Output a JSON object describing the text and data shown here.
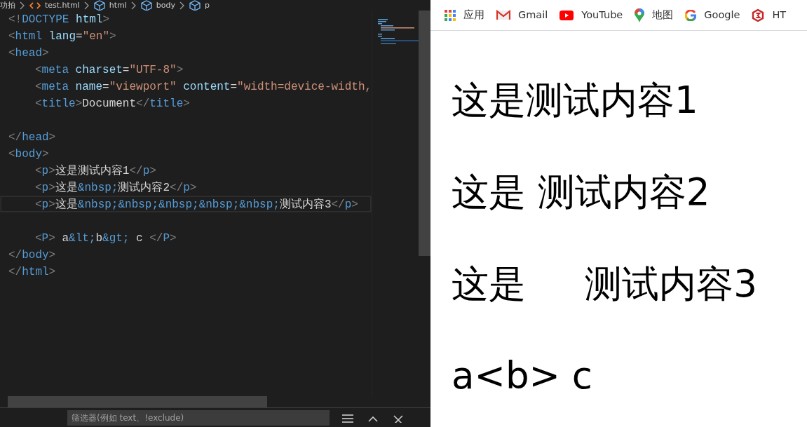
{
  "breadcrumb": [
    {
      "label": "功拍",
      "kind": "folder"
    },
    {
      "label": "test.html",
      "kind": "file"
    },
    {
      "label": "html",
      "kind": "element"
    },
    {
      "label": "body",
      "kind": "element"
    },
    {
      "label": "p",
      "kind": "element"
    }
  ],
  "code_lines": [
    {
      "current": false,
      "indented": false,
      "tokens": [
        {
          "kind": "punct",
          "text": "<!"
        },
        {
          "kind": "tag",
          "text": "DOCTYPE"
        },
        {
          "kind": "attr",
          "text": " html"
        },
        {
          "kind": "punct",
          "text": ">"
        }
      ]
    },
    {
      "current": false,
      "indented": false,
      "tokens": [
        {
          "kind": "punct",
          "text": "<"
        },
        {
          "kind": "tag",
          "text": "html"
        },
        {
          "kind": "attr",
          "text": " lang"
        },
        {
          "kind": "plain",
          "text": "="
        },
        {
          "kind": "string",
          "text": "\"en\""
        },
        {
          "kind": "punct",
          "text": ">"
        }
      ]
    },
    {
      "current": false,
      "indented": false,
      "tokens": [
        {
          "kind": "punct",
          "text": "<"
        },
        {
          "kind": "tag",
          "text": "head"
        },
        {
          "kind": "punct",
          "text": ">"
        }
      ]
    },
    {
      "current": false,
      "indented": true,
      "tokens": [
        {
          "kind": "punct",
          "text": "<"
        },
        {
          "kind": "tag",
          "text": "meta"
        },
        {
          "kind": "attr",
          "text": " charset"
        },
        {
          "kind": "plain",
          "text": "="
        },
        {
          "kind": "string",
          "text": "\"UTF-8\""
        },
        {
          "kind": "punct",
          "text": ">"
        }
      ]
    },
    {
      "current": false,
      "indented": true,
      "tokens": [
        {
          "kind": "punct",
          "text": "<"
        },
        {
          "kind": "tag",
          "text": "meta"
        },
        {
          "kind": "attr",
          "text": " name"
        },
        {
          "kind": "plain",
          "text": "="
        },
        {
          "kind": "string",
          "text": "\"viewport\""
        },
        {
          "kind": "attr",
          "text": " content"
        },
        {
          "kind": "plain",
          "text": "="
        },
        {
          "kind": "string",
          "text": "\"width=device-width,"
        }
      ]
    },
    {
      "current": false,
      "indented": true,
      "tokens": [
        {
          "kind": "punct",
          "text": "<"
        },
        {
          "kind": "tag",
          "text": "title"
        },
        {
          "kind": "punct",
          "text": ">"
        },
        {
          "kind": "plain",
          "text": "Document"
        },
        {
          "kind": "punct",
          "text": "</"
        },
        {
          "kind": "tag",
          "text": "title"
        },
        {
          "kind": "punct",
          "text": ">"
        }
      ]
    },
    {
      "current": false
    },
    {
      "current": false,
      "indented": false,
      "tokens": [
        {
          "kind": "punct",
          "text": "</"
        },
        {
          "kind": "tag",
          "text": "head"
        },
        {
          "kind": "punct",
          "text": ">"
        }
      ]
    },
    {
      "current": false,
      "indented": false,
      "tokens": [
        {
          "kind": "punct",
          "text": "<"
        },
        {
          "kind": "tag",
          "text": "body"
        },
        {
          "kind": "punct",
          "text": ">"
        }
      ]
    },
    {
      "current": false,
      "indented": true,
      "tokens": [
        {
          "kind": "punct",
          "text": "<"
        },
        {
          "kind": "tag",
          "text": "p"
        },
        {
          "kind": "punct",
          "text": ">"
        },
        {
          "kind": "plain",
          "text": "这是测试内容1"
        },
        {
          "kind": "punct",
          "text": "</"
        },
        {
          "kind": "tag",
          "text": "p"
        },
        {
          "kind": "punct",
          "text": ">"
        }
      ]
    },
    {
      "current": false,
      "indented": true,
      "tokens": [
        {
          "kind": "punct",
          "text": "<"
        },
        {
          "kind": "tag",
          "text": "p"
        },
        {
          "kind": "punct",
          "text": ">"
        },
        {
          "kind": "plain",
          "text": "这是"
        },
        {
          "kind": "entity",
          "text": "&nbsp;"
        },
        {
          "kind": "plain",
          "text": "测试内容2"
        },
        {
          "kind": "punct",
          "text": "</"
        },
        {
          "kind": "tag",
          "text": "p"
        },
        {
          "kind": "punct",
          "text": ">"
        }
      ]
    },
    {
      "current": true,
      "indented": true,
      "tokens": [
        {
          "kind": "punct",
          "text": "<"
        },
        {
          "kind": "tag",
          "text": "p"
        },
        {
          "kind": "punct",
          "text": ">"
        },
        {
          "kind": "plain",
          "text": "这是"
        },
        {
          "kind": "entity",
          "text": "&nbsp;&nbsp;&nbsp;&nbsp;&nbsp;"
        },
        {
          "kind": "plain",
          "text": "测试内容3"
        },
        {
          "kind": "punct",
          "text": "</"
        },
        {
          "kind": "tag",
          "text": "p"
        },
        {
          "kind": "punct",
          "text": ">"
        }
      ]
    },
    {
      "current": false
    },
    {
      "current": false,
      "indented": true,
      "tokens": [
        {
          "kind": "punct",
          "text": "<"
        },
        {
          "kind": "tag",
          "text": "P"
        },
        {
          "kind": "punct",
          "text": ">"
        },
        {
          "kind": "plain",
          "text": " a"
        },
        {
          "kind": "entity",
          "text": "&lt;"
        },
        {
          "kind": "plain",
          "text": "b"
        },
        {
          "kind": "entity",
          "text": "&gt;"
        },
        {
          "kind": "plain",
          "text": " c "
        },
        {
          "kind": "punct",
          "text": "</"
        },
        {
          "kind": "tag",
          "text": "P"
        },
        {
          "kind": "punct",
          "text": ">"
        }
      ]
    },
    {
      "current": false,
      "indented": false,
      "tokens": [
        {
          "kind": "punct",
          "text": "</"
        },
        {
          "kind": "tag",
          "text": "body"
        },
        {
          "kind": "punct",
          "text": ">"
        }
      ]
    },
    {
      "current": false,
      "indented": false,
      "tokens": [
        {
          "kind": "punct",
          "text": "</"
        },
        {
          "kind": "tag",
          "text": "html"
        },
        {
          "kind": "punct",
          "text": ">"
        }
      ]
    }
  ],
  "panel": {
    "filter": {
      "placeholder": "筛选器(例如 text、!exclude)"
    }
  },
  "bookmarks": [
    {
      "label": "应用",
      "kind": "apps"
    },
    {
      "label": "Gmail",
      "kind": "gmail"
    },
    {
      "label": "YouTube",
      "kind": "youtube"
    },
    {
      "label": "地图",
      "kind": "maps"
    },
    {
      "label": "Google",
      "kind": "google"
    },
    {
      "label": "HT",
      "kind": "shield"
    }
  ],
  "page_paragraphs": [
    "这是测试内容1",
    "这是 测试内容2",
    "这是     测试内容3",
    "a<b> c"
  ]
}
